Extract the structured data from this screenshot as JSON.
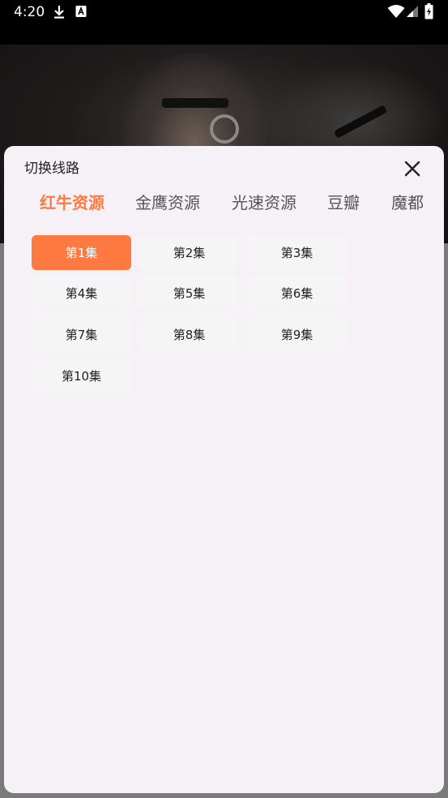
{
  "status_bar": {
    "time": "4:20",
    "left_icons": [
      "download-icon",
      "text-a-icon"
    ],
    "right_icons": [
      "wifi-icon",
      "signal-icon",
      "battery-charging-icon"
    ]
  },
  "video": {
    "state": "loading",
    "spinner_icon": "loading-ring-icon"
  },
  "sheet": {
    "title": "切换线路",
    "close_icon": "close-icon",
    "sources": [
      {
        "label": "红牛资源",
        "active": true
      },
      {
        "label": "金鹰资源",
        "active": false
      },
      {
        "label": "光速资源",
        "active": false
      },
      {
        "label": "豆瓣",
        "active": false
      },
      {
        "label": "魔都",
        "active": false
      }
    ],
    "episodes": [
      {
        "label": "第1集",
        "active": true
      },
      {
        "label": "第2集",
        "active": false
      },
      {
        "label": "第3集",
        "active": false
      },
      {
        "label": "第4集",
        "active": false
      },
      {
        "label": "第5集",
        "active": false
      },
      {
        "label": "第6集",
        "active": false
      },
      {
        "label": "第7集",
        "active": false
      },
      {
        "label": "第8集",
        "active": false
      },
      {
        "label": "第9集",
        "active": false
      },
      {
        "label": "第10集",
        "active": false
      }
    ]
  },
  "colors": {
    "accent": "#ff7a40",
    "sheet_background": "#f6f0f7",
    "episode_background": "#f5f5f5"
  }
}
